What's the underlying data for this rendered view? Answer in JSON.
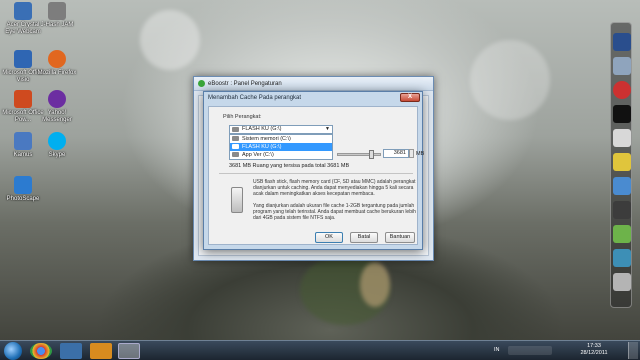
{
  "desktop": {
    "icons": [
      {
        "label": "Acer Crystal Eye Webcam",
        "icon": "webcam-icon",
        "color": "#3a6fb5"
      },
      {
        "label": "J-Hash JAM",
        "icon": "app-icon",
        "color": "#7d7d7d"
      },
      {
        "label": "Microsoft Office Visio",
        "icon": "visio-icon",
        "color": "#2f66b3"
      },
      {
        "label": "Mozilla Firefox",
        "icon": "firefox-icon",
        "color": "#e1671f"
      },
      {
        "label": "Microsoft Office Pow...",
        "icon": "powerpoint-icon",
        "color": "#cf4a1f"
      },
      {
        "label": "Yahoo! Messenger",
        "icon": "messenger-icon",
        "color": "#6c2ea1"
      },
      {
        "label": "Kamus",
        "icon": "dictionary-icon",
        "color": "#4a79c1"
      },
      {
        "label": "Skype",
        "icon": "skype-icon",
        "color": "#00aff0"
      },
      {
        "label": "PhotoScape",
        "icon": "photoscape-icon",
        "color": "#2c7bd0"
      }
    ]
  },
  "window": {
    "title": "eBoostr : Panel Pengaturan"
  },
  "dialog": {
    "title": "Menambah Cache Pada perangkat",
    "close_label": "X",
    "device_label": "Pilih Perangkat:",
    "selected_device": "FLASH KU (G:\\)",
    "options": [
      {
        "label": "Sistem memori (C:\\)",
        "selected": false
      },
      {
        "label": "FLASH KU (G:\\)",
        "selected": true
      },
      {
        "label": "App Ver (C:\\)",
        "selected": false
      }
    ],
    "size_value": "3681",
    "size_unit": "MB",
    "space_text": "3681 MB Ruang yang tersisa pada total 3681 MB",
    "info_paragraph_1": "USB flash stick, flash memory card (CF, SD atau MMC) adalah perangkat dianjurkan untuk caching. Anda dapat menyediakan hingga 5 kali secara acak dalam meningkatkan akses kecepatan membaca.",
    "info_paragraph_2": "Yang dianjurkan adalah ukuran file cache 1-2GB tergantung pada jumlah program yang telah terinstal. Anda dapat membuat cache berukuran lebih dari 4GB pada sistem file NTFS saja.",
    "ok_label": "OK",
    "cancel_label": "Batal",
    "help_label": "Bantuan"
  },
  "taskbar": {
    "language": "IN",
    "time": "17:33",
    "date": "28/12/2011"
  },
  "colors": {
    "selection": "#3399ff",
    "dialog_frame": "#c6d8ea"
  }
}
